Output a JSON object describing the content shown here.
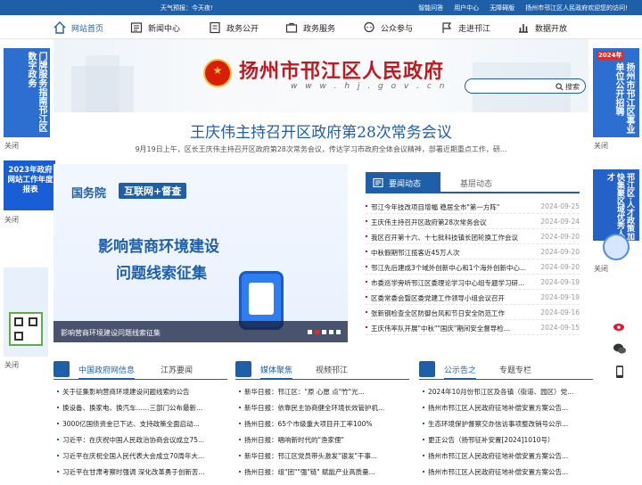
{
  "topbar": {
    "weather": "天气预报：今天夜!",
    "links": [
      "智能问答",
      "用户中心",
      "无障碍版",
      "扬州市邗江区人民政府欢迎您的访问!"
    ]
  },
  "nav": {
    "items": [
      {
        "label": "网站首页",
        "icon": "home-icon"
      },
      {
        "label": "新闻中心",
        "icon": "news-icon"
      },
      {
        "label": "政务公开",
        "icon": "document-icon"
      },
      {
        "label": "政务服务",
        "icon": "briefcase-icon"
      },
      {
        "label": "公众参与",
        "icon": "chat-icon"
      },
      {
        "label": "走进邗江",
        "icon": "flag-icon"
      },
      {
        "label": "数据开放",
        "icon": "chart-icon"
      }
    ]
  },
  "header": {
    "title": "扬州市邗江区人民政府",
    "url": "w w w . h j . g o v . c n",
    "search_placeholder": "",
    "search_label": "搜索"
  },
  "headline": {
    "title": "王庆伟主持召开区政府第28次常务会议",
    "summary": "9月19日上午，区长王庆伟主持召开区政府第28次常务会议，传达学习市政府全体会议精神，部署近期重点工作，研..."
  },
  "floats": {
    "left1": "门牌服务指南邗江区数字政务",
    "left2": "2023年政府网站工作年度报表",
    "left3": "",
    "right1_top": "2024年",
    "right1": "扬州市邗江区事业单位公开招聘",
    "right2": "邗江区·人才政策加快集聚区域优秀人才",
    "close": "关闭"
  },
  "slide": {
    "tag1": "国务院",
    "tag2": "互联网+督查",
    "line1": "影响营商环境建设",
    "line2": "问题线索征集",
    "caption": "影响营商环境建设问题线索征集"
  },
  "news": {
    "tab_active": "要闻动态",
    "tab_other": "基层动态",
    "rows": [
      {
        "t": "邗江今年技改项目增幅 稳居全市\"第一方阵\"",
        "d": "2024-09-25"
      },
      {
        "t": "王庆伟主持召开区政府第28次常务会议",
        "d": "2024-09-24"
      },
      {
        "t": "我区召开第十六、十七批科技镇长团轮换工作会议",
        "d": "2024-09-20"
      },
      {
        "t": "中秋假期邗江揽客近45万人次",
        "d": "2024-09-20"
      },
      {
        "t": "邗江先后建成3个域外创新中心和1个海外创新中心...",
        "d": "2024-09-20"
      },
      {
        "t": "市委巡学旁听邗江区委理论学习中心组专题学习研...",
        "d": "2024-09-19"
      },
      {
        "t": "区委常委会暨区委党建工作领导小组会议召开",
        "d": "2024-09-19"
      },
      {
        "t": "张新钢检查全区防御台风和节日安全防范工作",
        "d": "2024-09-16"
      },
      {
        "t": "王庆伟率队开展\"中秋\"\"国庆\"期间安全督导检...",
        "d": "2024-09-15"
      }
    ]
  },
  "columns": [
    {
      "t1": "中国政府网信息",
      "t2": "江苏要闻",
      "rows": [
        "关于征集影响营商环境建设问题线索的公告",
        "换设备、换家电、换汽车……三部门公布最新...",
        "3000亿国债资金已下达、支持政策全面启动...",
        "习近平：在庆祝中国人民政治协商会议成立75...",
        "习近平在庆祝全国人民代表大会成立70周年大...",
        "习近平在甘肃考察时强调 深化改革勇于创新苦..."
      ]
    },
    {
      "t1": "媒体聚焦",
      "t2": "视频邗江",
      "rows": [
        "新华日报：邗江区：\"原 心愿 点\"竹\"光...",
        "新华日报：依靠民主协商健全环境长效管护机...",
        "扬州日报：65个市级重大项目开工率100%",
        "扬州日报：唱响新时代的\"渔家俚\"",
        "新华日报：邗江区党员带头激发\"银发\"干事...",
        "扬州日报：组\"团\"\"强\"链\" 赋能产业高质量..."
      ]
    },
    {
      "t1": "公示告之",
      "t2": "专题专栏",
      "rows": [
        "2024年10月份邗江区及各镇（街道、园区）党...",
        "扬州市邗江区人民政府征地补偿安置方案公告...",
        "生态环境保护督察交办信访事项整改销号公示...",
        "更正公告（扬邗征补安置[2024]1010号）",
        "扬州市邗江区人民政府征地补偿安置方案公告...",
        "扬州市邗江区人民政府征地补偿安置方案公告..."
      ]
    }
  ],
  "colors": {
    "primary": "#1f5fa8",
    "accent": "#c0191f"
  }
}
